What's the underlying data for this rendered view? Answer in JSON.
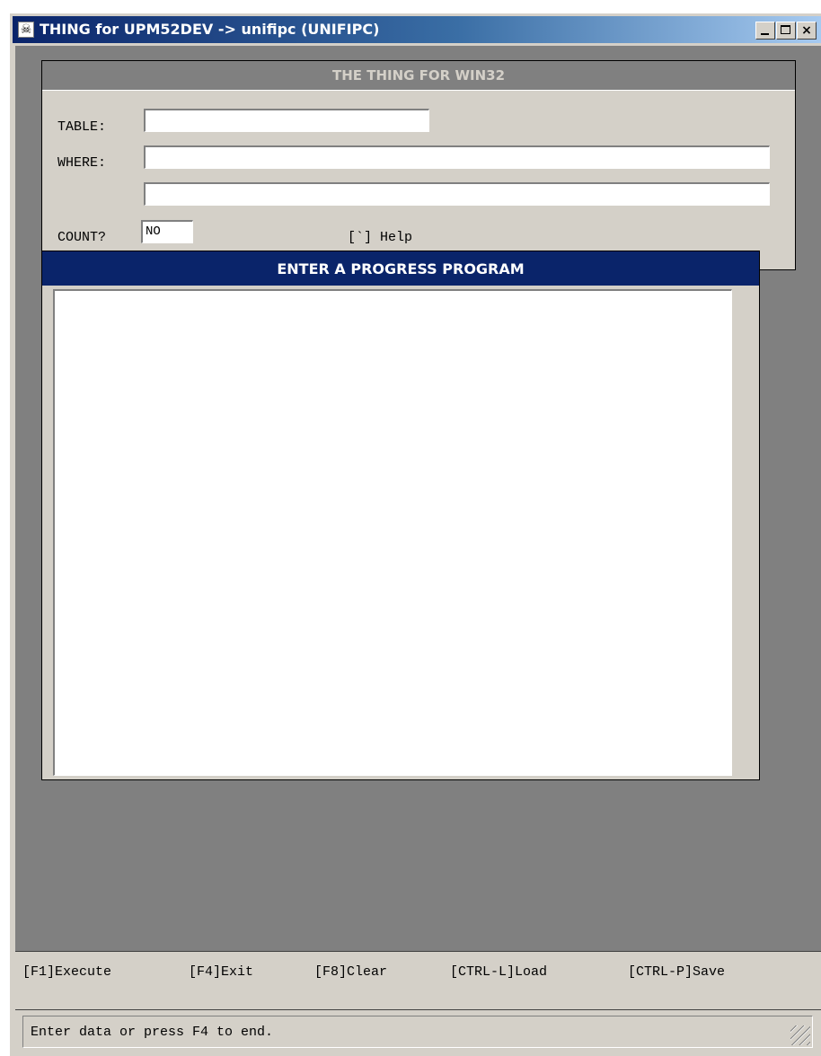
{
  "window": {
    "title": "THING for UPM52DEV -> unifipc (UNIFIPC)",
    "icon": "skull-crossbones-icon",
    "controls": {
      "minimize": "minimize-icon",
      "maximize": "maximize-icon",
      "close": "×"
    }
  },
  "query_panel": {
    "header": "THE THING FOR WIN32",
    "table_label": "TABLE:",
    "table_value": "",
    "where_label": "WHERE:",
    "where_value_1": "",
    "where_value_2": "",
    "count_label": "COUNT?",
    "count_value": "NO",
    "help_hint": "[`] Help"
  },
  "editor": {
    "header": "ENTER A PROGRESS PROGRAM",
    "content": ""
  },
  "function_keys": [
    "[F1]Execute",
    "[F4]Exit",
    "[F8]Clear",
    "[CTRL-L]Load",
    "[CTRL-P]Save"
  ],
  "status": {
    "message": "Enter data or press F4 to end."
  },
  "colors": {
    "title_gradient_start": "#0a246a",
    "title_gradient_end": "#a6caf0",
    "editor_header_bg": "#0a246a",
    "workarea_bg": "#808080",
    "panel_bg": "#d4d0c8"
  }
}
